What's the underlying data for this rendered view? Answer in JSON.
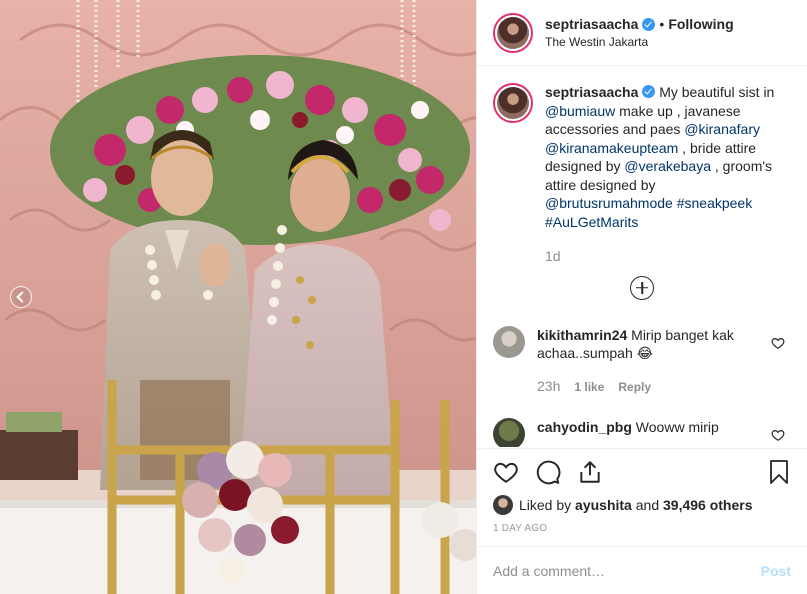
{
  "header": {
    "username": "septriasaacha",
    "separator": "•",
    "follow_label": "Following",
    "location": "The Westin Jakarta"
  },
  "caption": {
    "username": "septriasaacha",
    "segments": [
      {
        "text": "My beautiful sist in ",
        "mention": false
      },
      {
        "text": "@bumiauw",
        "mention": true
      },
      {
        "text": " make up , javanese accessories and paes ",
        "mention": false
      },
      {
        "text": "@kiranafary",
        "mention": true
      },
      {
        "text": " ",
        "mention": false
      },
      {
        "text": "@kiranamakeupteam",
        "mention": true
      },
      {
        "text": " , bride attire designed by ",
        "mention": false
      },
      {
        "text": "@verakebaya",
        "mention": true
      },
      {
        "text": " , groom's attire designed by ",
        "mention": false
      },
      {
        "text": "@brutusrumahmode",
        "mention": true
      },
      {
        "text": " ",
        "mention": false
      },
      {
        "text": "#sneakpeek",
        "mention": true
      },
      {
        "text": " ",
        "mention": false
      },
      {
        "text": "#AuLGetMarits",
        "mention": true
      }
    ],
    "time": "1d"
  },
  "comments": [
    {
      "username": "kikithamrin24",
      "text": "Mirip banget kak achaa..sumpah 😂",
      "time": "23h",
      "likes": "1 like",
      "reply": "Reply"
    },
    {
      "username": "cahyodin_pbg",
      "text": "Wooww mirip"
    }
  ],
  "likes": {
    "prefix": "Liked by ",
    "user": "ayushita",
    "middle": " and ",
    "count": "39,496 others"
  },
  "timestamp": "1 DAY AGO",
  "add_comment": {
    "placeholder": "Add a comment…",
    "post_label": "Post"
  },
  "icons": {
    "like": "heart-icon",
    "comment": "comment-icon",
    "share": "share-icon",
    "save": "bookmark-icon",
    "load_more": "plus-circle-icon",
    "carousel": "chevron-left-icon"
  },
  "colors": {
    "mention": "#003569",
    "verified": "#3897f0",
    "muted": "#8e8e8e",
    "post_disabled": "#b2dffc"
  }
}
